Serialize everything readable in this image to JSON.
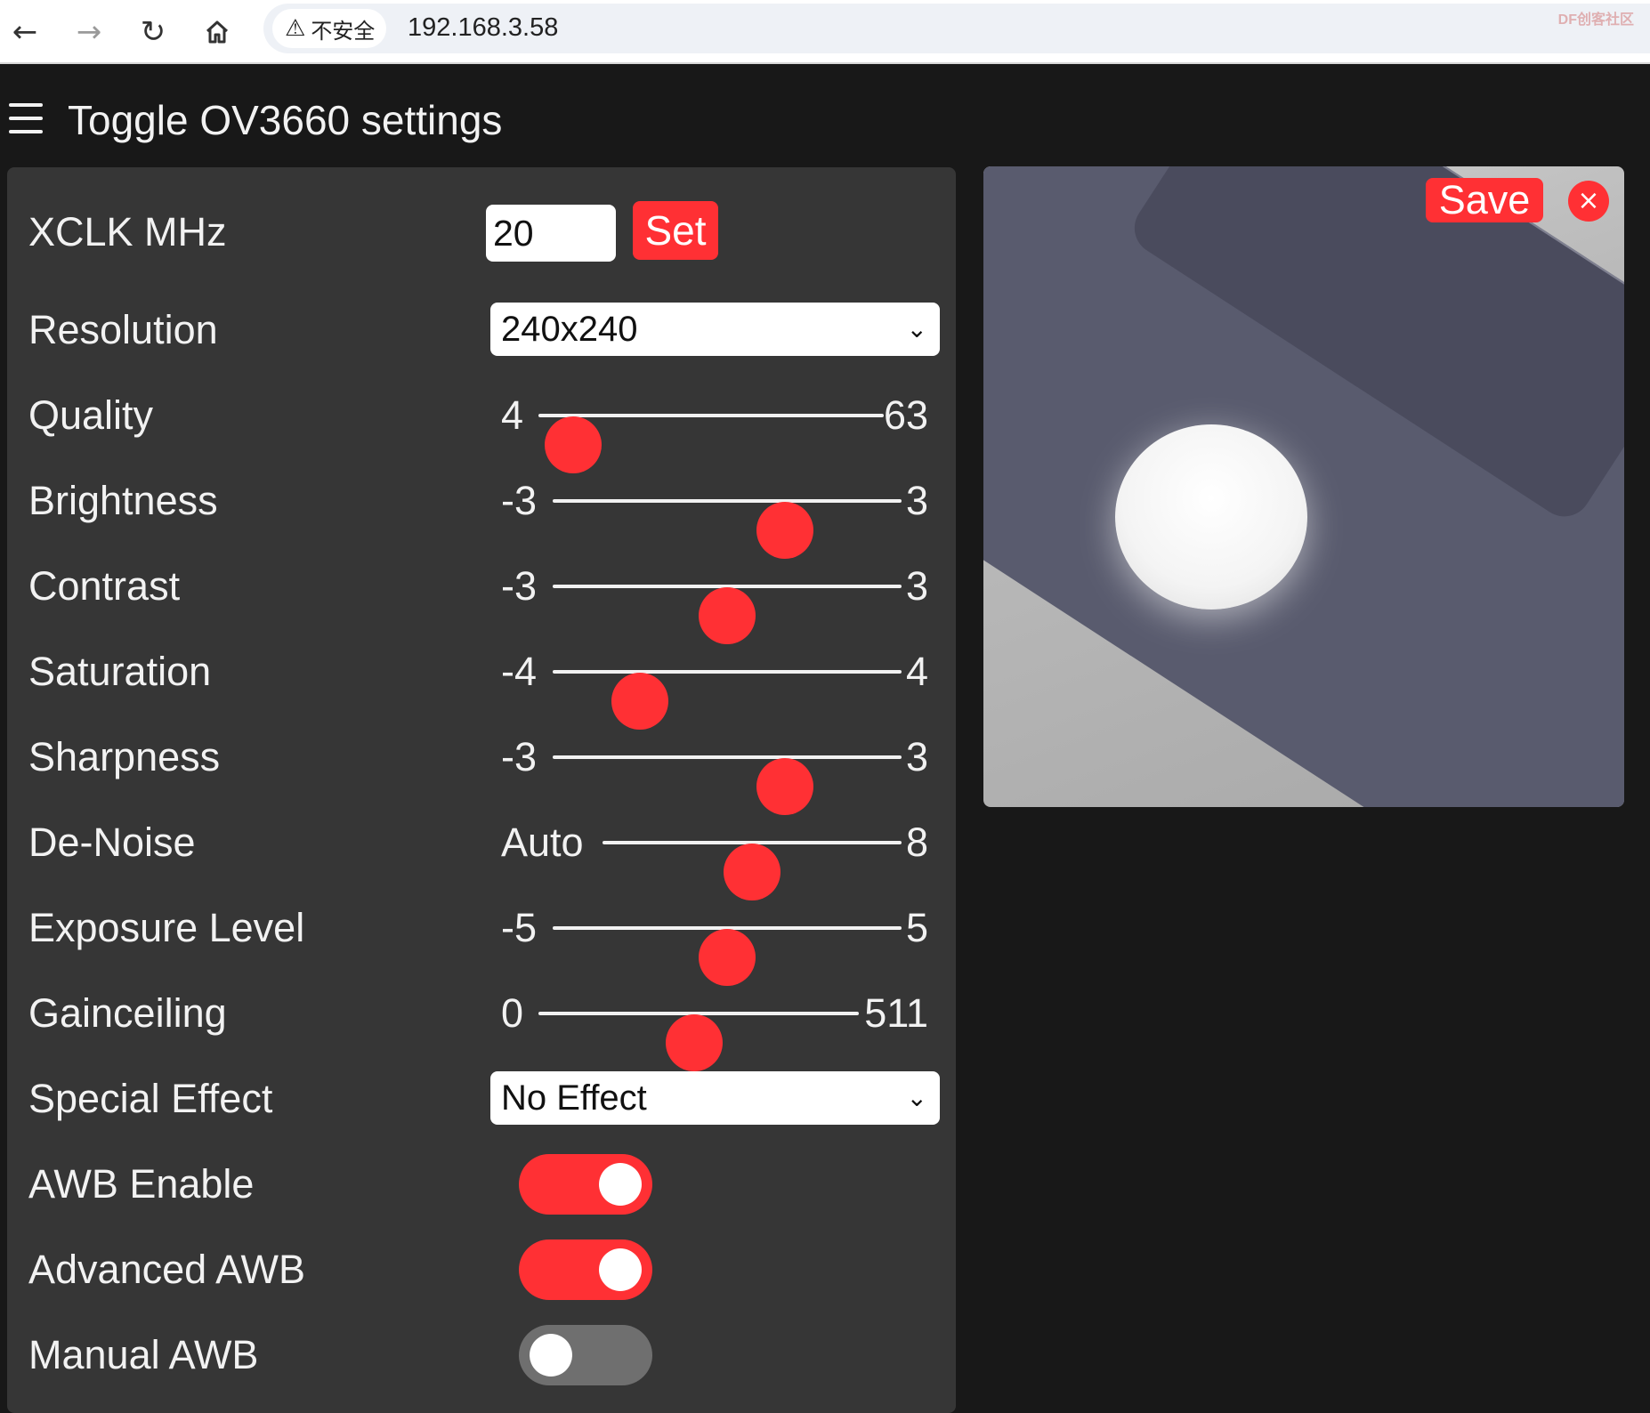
{
  "browser": {
    "security_label": "不安全",
    "url": "192.168.3.58",
    "watermark": "DF创客社区"
  },
  "header": {
    "title": "Toggle OV3660 settings"
  },
  "settings": {
    "xclk": {
      "label": "XCLK MHz",
      "value": "20",
      "button": "Set"
    },
    "resolution": {
      "label": "Resolution",
      "selected": "240x240"
    },
    "quality": {
      "label": "Quality",
      "min": "4",
      "max": "63",
      "value": 10
    },
    "brightness": {
      "label": "Brightness",
      "min": "-3",
      "max": "3",
      "value": 1
    },
    "contrast": {
      "label": "Contrast",
      "min": "-3",
      "max": "3",
      "value": 0
    },
    "saturation": {
      "label": "Saturation",
      "min": "-4",
      "max": "4",
      "value": -2
    },
    "sharpness": {
      "label": "Sharpness",
      "min": "-3",
      "max": "3",
      "value": 1
    },
    "denoise": {
      "label": "De-Noise",
      "min": "Auto",
      "max": "8",
      "fraction": 0.5
    },
    "exposure": {
      "label": "Exposure Level",
      "min": "-5",
      "max": "5",
      "value": 0
    },
    "gainceiling": {
      "label": "Gainceiling",
      "min": "0",
      "max": "511",
      "value": 248
    },
    "special_effect": {
      "label": "Special Effect",
      "selected": "No Effect"
    },
    "awb": {
      "label": "AWB Enable",
      "on": true
    },
    "adv_awb": {
      "label": "Advanced AWB",
      "on": true
    },
    "manual_awb": {
      "label": "Manual AWB",
      "on": false
    }
  },
  "preview": {
    "save_label": "Save",
    "close_glyph": "×"
  },
  "colors": {
    "accent": "#ff3034",
    "panel": "#363636",
    "background": "#181818"
  },
  "icons": {
    "back": "arrow-left-icon",
    "forward": "arrow-right-icon",
    "reload": "reload-icon",
    "home": "home-icon",
    "menu": "hamburger-icon",
    "warning": "warning-triangle-icon",
    "chevron": "chevron-down-icon",
    "close": "close-icon"
  }
}
